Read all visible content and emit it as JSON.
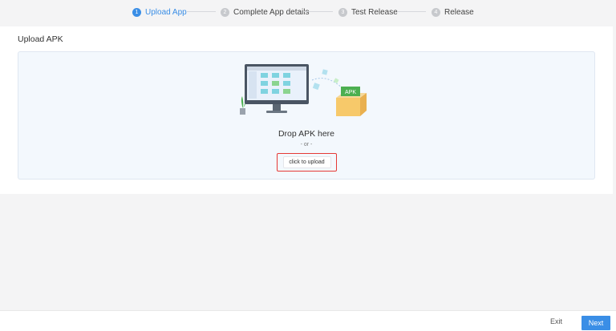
{
  "steps": [
    {
      "num": "1",
      "label": "Upload App",
      "active": true
    },
    {
      "num": "2",
      "label": "Complete App details",
      "active": false
    },
    {
      "num": "3",
      "label": "Test Release",
      "active": false
    },
    {
      "num": "4",
      "label": "Release",
      "active": false
    }
  ],
  "card": {
    "title": "Upload APK",
    "drop_text": "Drop APK here",
    "or_text": "- or -",
    "upload_label": "click to upload",
    "apk_label": "APK"
  },
  "footer": {
    "exit_label": "Exit",
    "next_label": "Next"
  },
  "colors": {
    "accent": "#3a8ee6",
    "highlight": "#e53935",
    "apk_green": "#4caf50"
  }
}
